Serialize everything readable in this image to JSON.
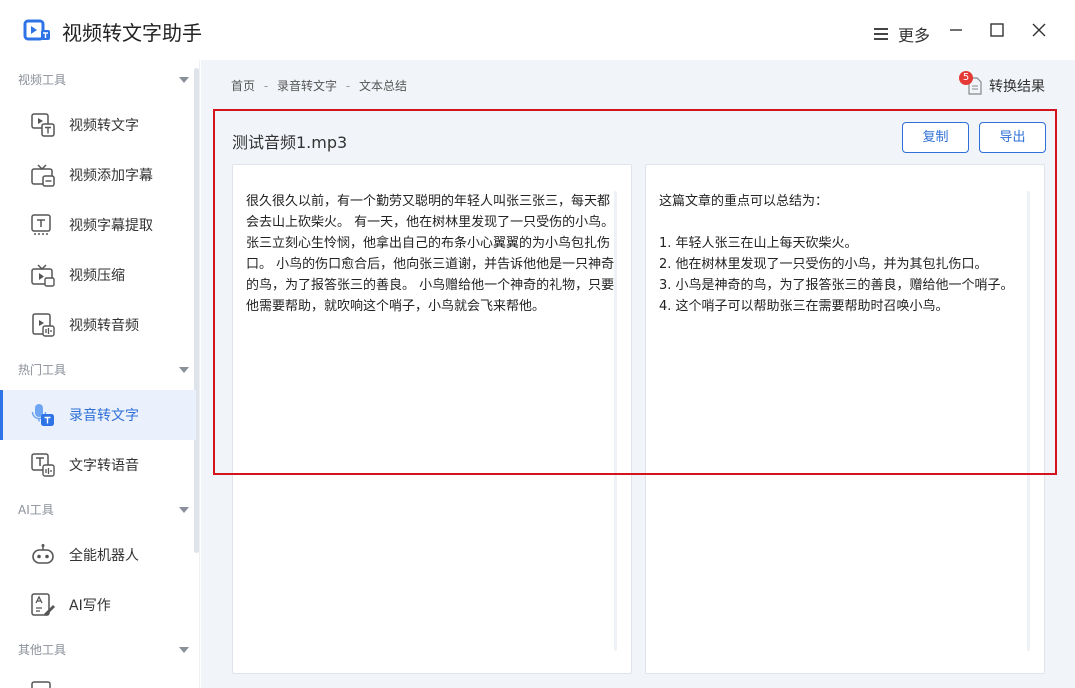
{
  "app": {
    "title": "视频转文字助手",
    "more_label": "更多"
  },
  "colors": {
    "accent": "#2e6fd8",
    "highlight": "#d3141c",
    "badge": "#e53935"
  },
  "sidebar": {
    "sections": [
      {
        "label": "视频工具"
      },
      {
        "label": "热门工具"
      },
      {
        "label": "AI工具"
      },
      {
        "label": "其他工具"
      }
    ],
    "items": [
      {
        "label": "视频转文字",
        "icon": "video-to-text-icon"
      },
      {
        "label": "视频添加字幕",
        "icon": "tv-subtitle-icon"
      },
      {
        "label": "视频字幕提取",
        "icon": "subtitle-extract-icon"
      },
      {
        "label": "视频压缩",
        "icon": "video-compress-icon"
      },
      {
        "label": "视频转音频",
        "icon": "video-audio-icon"
      },
      {
        "label": "录音转文字",
        "icon": "mic-text-icon",
        "active": true
      },
      {
        "label": "文字转语音",
        "icon": "text-speech-icon"
      },
      {
        "label": "全能机器人",
        "icon": "robot-icon"
      },
      {
        "label": "AI写作",
        "icon": "ai-write-icon"
      }
    ]
  },
  "breadcrumb": {
    "items": [
      "首页",
      "录音转文字",
      "文本总结"
    ],
    "sep": "-"
  },
  "result": {
    "label": "转换结果",
    "badge": "5"
  },
  "panel": {
    "file_name": "测试音频1.mp3",
    "copy_label": "复制",
    "export_label": "导出",
    "original_text": "很久很久以前，有一个勤劳又聪明的年轻人叫张三张三，每天都会去山上砍柴火。 有一天，他在树林里发现了一只受伤的小鸟。张三立刻心生怜悯，他拿出自己的布条小心翼翼的为小鸟包扎伤口。 小鸟的伤口愈合后，他向张三道谢，并告诉他他是一只神奇的鸟，为了报答张三的善良。 小鸟赠给他一个神奇的礼物，只要他需要帮助，就吹响这个哨子，小鸟就会飞来帮他。",
    "summary_text": "这篇文章的重点可以总结为：\n\n1. 年轻人张三在山上每天砍柴火。\n2. 他在树林里发现了一只受伤的小鸟，并为其包扎伤口。\n3. 小鸟是神奇的鸟，为了报答张三的善良，赠给他一个哨子。\n4. 这个哨子可以帮助张三在需要帮助时召唤小鸟。"
  }
}
